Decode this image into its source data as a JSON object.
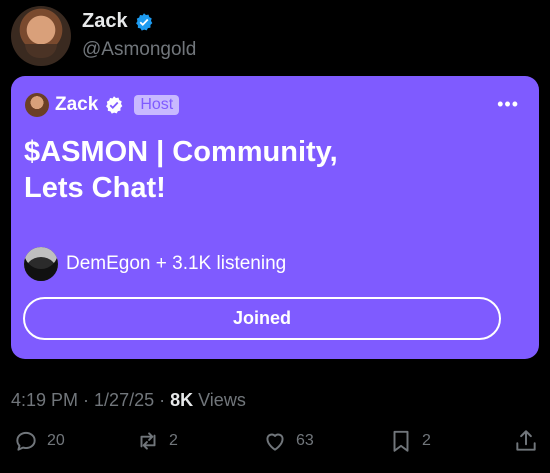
{
  "post": {
    "author_name": "Zack",
    "author_handle": "@Asmongold"
  },
  "space": {
    "host_name": "Zack",
    "host_badge": "Host",
    "more_label": "•••",
    "title_line1": "$ASMON | Community,",
    "title_line2": "Lets Chat!",
    "listeners_text": "DemEgon + 3.1K listening",
    "button_label": "Joined",
    "card_color": "#7f5bff"
  },
  "meta": {
    "time": "4:19 PM",
    "date": "1/27/25",
    "sep1": " · ",
    "sep2": " · ",
    "views_count": "8K",
    "views_label": " Views"
  },
  "actions": {
    "replies": "20",
    "reposts": "2",
    "likes": "63",
    "bookmarks": "2"
  },
  "colors": {
    "background": "#000000",
    "muted_text": "#71767b",
    "verified_blue": "#1d9bf0"
  },
  "icons": {
    "reply": "speech-bubble-icon",
    "repost": "repost-arrows-icon",
    "like": "heart-icon",
    "bookmark": "bookmark-icon",
    "share": "share-upload-icon",
    "verified": "verified-badge-icon"
  }
}
